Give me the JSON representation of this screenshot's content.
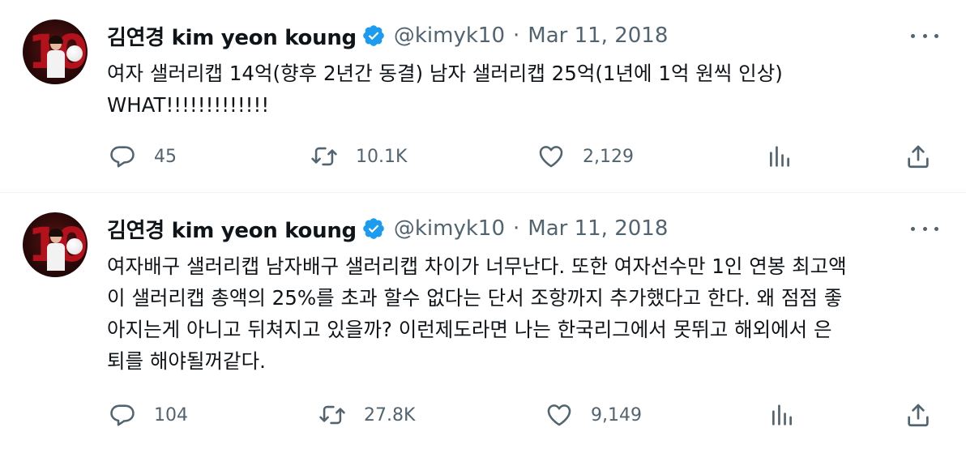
{
  "tweets": [
    {
      "display_name": "김연경 kim yeon koung",
      "handle": "@kimyk10",
      "separator": "·",
      "date": "Mar 11, 2018",
      "text": "여자 샐러리캡 14억(향후 2년간 동결) 남자 샐러리캡 25억(1년에 1억 원씩 인상)\nWHAT!!!!!!!!!!!!!",
      "replies": "45",
      "retweets": "10.1K",
      "likes": "2,129"
    },
    {
      "display_name": "김연경 kim yeon koung",
      "handle": "@kimyk10",
      "separator": "·",
      "date": "Mar 11, 2018",
      "text": "여자배구 샐러리캡 남자배구 샐러리캡 차이가 너무난다. 또한 여자선수만 1인 연봉 최고액\n이 샐러리캡 총액의 25%를 초과 할수 없다는 단서 조항까지 추가했다고 한다. 왜 점점 좋\n아지는게 아니고 뒤쳐지고 있을까? 이런제도라면 나는 한국리그에서 못뛰고 해외에서 은\n퇴를 해야될꺼같다.",
      "replies": "104",
      "retweets": "27.8K",
      "likes": "9,149"
    }
  ],
  "avatar_text": "10",
  "icons": [
    "verified-badge-icon",
    "more-icon",
    "reply-icon",
    "retweet-icon",
    "like-icon",
    "analytics-icon",
    "share-icon"
  ],
  "colors": {
    "text": "#0f1419",
    "secondary": "#536471",
    "verified": "#1d9bf0",
    "divider": "#eff3f4"
  }
}
